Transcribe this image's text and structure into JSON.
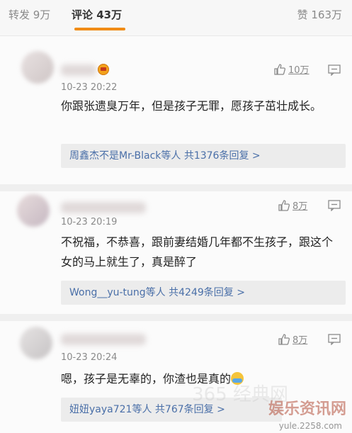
{
  "tabs": {
    "repost": "转发 9万",
    "comments": "评论 43万",
    "likes": "赞 163万"
  },
  "colors": {
    "accent": "#f08c17",
    "link": "#4a6fa8"
  },
  "comments": [
    {
      "time": "10-23 20:22",
      "text": "你跟张遗臭万年，但是孩子无罪，愿孩子茁壮成长。",
      "likes": "10万",
      "reply_who": "周鑫杰不是Mr-Black等人",
      "reply_count": "共1376条回复 >"
    },
    {
      "time": "10-23 20:19",
      "text": "不祝福，不恭喜，跟前妻结婚几年都不生孩子，跟这个女的马上就生了，真是醉了",
      "likes": "8万",
      "reply_who": "Wong__yu-tung等人",
      "reply_count": "共4249条回复 >"
    },
    {
      "time": "10-23 20:24",
      "text": "嗯，孩子是无辜的，你渣也是真的",
      "likes": "8万",
      "reply_who": "妞妞yaya721等人",
      "reply_count": "共767条回复 >"
    }
  ],
  "watermark": {
    "ghost": "365 经典网",
    "brand": "娱乐资讯网",
    "url": "yule.2258.com"
  }
}
